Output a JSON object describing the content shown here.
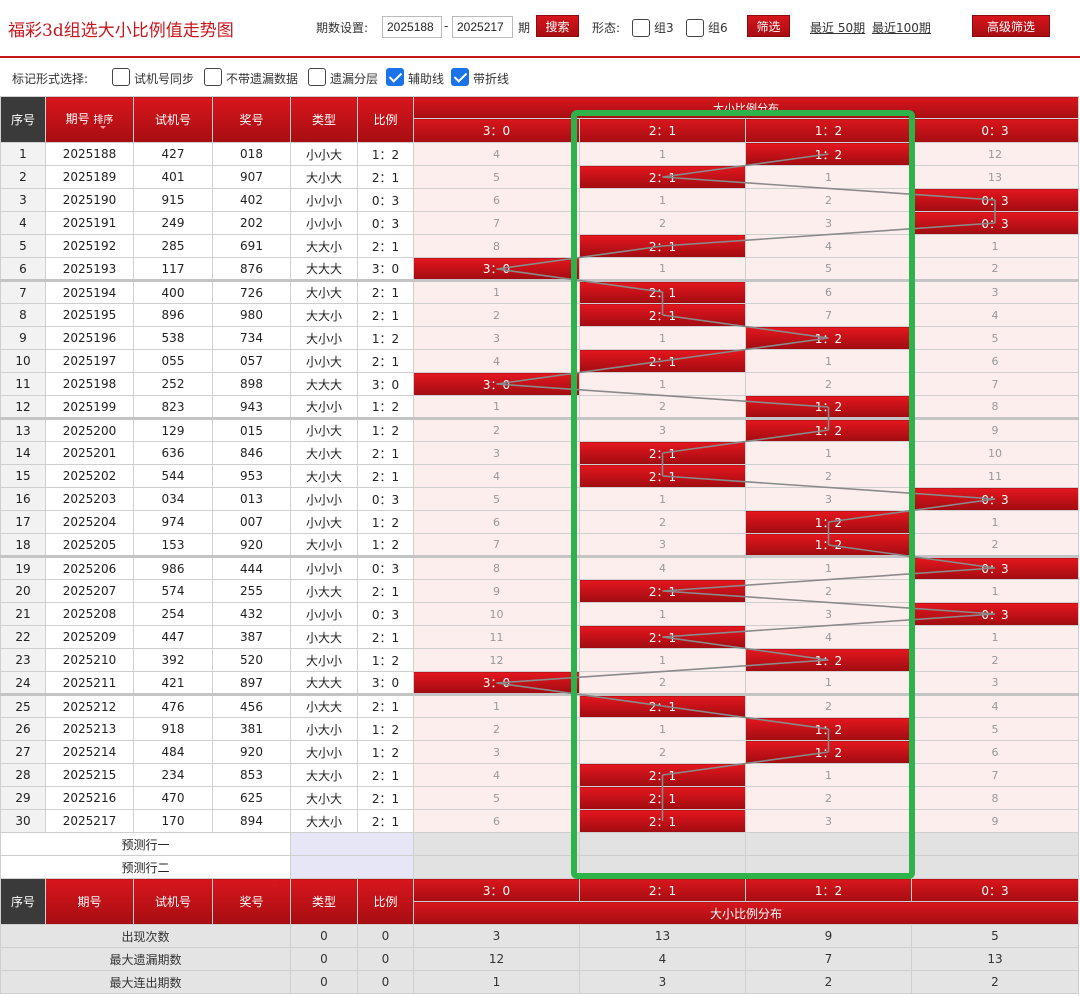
{
  "page": {
    "title": "福彩3d组选大小比例值走势图"
  },
  "toolbar": {
    "period_label": "期数设置:",
    "start_period": "2025188",
    "dash": "-",
    "end_period": "2025217",
    "period_suffix": "期",
    "search_label": "搜索",
    "shape_label": "形态:",
    "group3_label": "组3",
    "group6_label": "组6",
    "filter_label": "筛选",
    "recent50_label": "最近 50期",
    "recent100_label": "最近100期",
    "advanced_label": "高级筛选"
  },
  "markers": {
    "label": "标记形式选择:",
    "options": [
      {
        "label": "试机号同步",
        "checked": false
      },
      {
        "label": "不带遗漏数据",
        "checked": false
      },
      {
        "label": "遗漏分层",
        "checked": false
      },
      {
        "label": "辅助线",
        "checked": true
      },
      {
        "label": "带折线",
        "checked": true
      }
    ]
  },
  "table": {
    "headers": {
      "idx": "序号",
      "period": "期号",
      "sort": "排序",
      "trial": "试机号",
      "draw": "奖号",
      "type": "类型",
      "ratio": "比例",
      "dist_title": "大小比例分布",
      "dist_cols": [
        "3：0",
        "2：1",
        "1：2",
        "0：3"
      ]
    },
    "rows": [
      {
        "idx": "1",
        "period": "2025188",
        "trial": "427",
        "draw": "018",
        "type": "小小大",
        "ratio": "1：2",
        "hit": 2,
        "dist": [
          "4",
          "1",
          "1：2",
          "12"
        ]
      },
      {
        "idx": "2",
        "period": "2025189",
        "trial": "401",
        "draw": "907",
        "type": "大小大",
        "ratio": "2：1",
        "hit": 1,
        "dist": [
          "5",
          "2：1",
          "1",
          "13"
        ]
      },
      {
        "idx": "3",
        "period": "2025190",
        "trial": "915",
        "draw": "402",
        "type": "小小小",
        "ratio": "0：3",
        "hit": 3,
        "dist": [
          "6",
          "1",
          "2",
          "0：3"
        ]
      },
      {
        "idx": "4",
        "period": "2025191",
        "trial": "249",
        "draw": "202",
        "type": "小小小",
        "ratio": "0：3",
        "hit": 3,
        "dist": [
          "7",
          "2",
          "3",
          "0：3"
        ]
      },
      {
        "idx": "5",
        "period": "2025192",
        "trial": "285",
        "draw": "691",
        "type": "大大小",
        "ratio": "2：1",
        "hit": 1,
        "dist": [
          "8",
          "2：1",
          "4",
          "1"
        ]
      },
      {
        "idx": "6",
        "period": "2025193",
        "trial": "117",
        "draw": "876",
        "type": "大大大",
        "ratio": "3：0",
        "hit": 0,
        "dist": [
          "3：0",
          "1",
          "5",
          "2"
        ]
      },
      {
        "idx": "7",
        "period": "2025194",
        "trial": "400",
        "draw": "726",
        "type": "大小大",
        "ratio": "2：1",
        "hit": 1,
        "dist": [
          "1",
          "2：1",
          "6",
          "3"
        ]
      },
      {
        "idx": "8",
        "period": "2025195",
        "trial": "896",
        "draw": "980",
        "type": "大大小",
        "ratio": "2：1",
        "hit": 1,
        "dist": [
          "2",
          "2：1",
          "7",
          "4"
        ]
      },
      {
        "idx": "9",
        "period": "2025196",
        "trial": "538",
        "draw": "734",
        "type": "大小小",
        "ratio": "1：2",
        "hit": 2,
        "dist": [
          "3",
          "1",
          "1：2",
          "5"
        ]
      },
      {
        "idx": "10",
        "period": "2025197",
        "trial": "055",
        "draw": "057",
        "type": "小小大",
        "ratio": "2：1",
        "hit": 1,
        "dist": [
          "4",
          "2：1",
          "1",
          "6"
        ]
      },
      {
        "idx": "11",
        "period": "2025198",
        "trial": "252",
        "draw": "898",
        "type": "大大大",
        "ratio": "3：0",
        "hit": 0,
        "dist": [
          "3：0",
          "1",
          "2",
          "7"
        ]
      },
      {
        "idx": "12",
        "period": "2025199",
        "trial": "823",
        "draw": "943",
        "type": "大小小",
        "ratio": "1：2",
        "hit": 2,
        "dist": [
          "1",
          "2",
          "1：2",
          "8"
        ]
      },
      {
        "idx": "13",
        "period": "2025200",
        "trial": "129",
        "draw": "015",
        "type": "小小大",
        "ratio": "1：2",
        "hit": 2,
        "dist": [
          "2",
          "3",
          "1：2",
          "9"
        ]
      },
      {
        "idx": "14",
        "period": "2025201",
        "trial": "636",
        "draw": "846",
        "type": "大小大",
        "ratio": "2：1",
        "hit": 1,
        "dist": [
          "3",
          "2：1",
          "1",
          "10"
        ]
      },
      {
        "idx": "15",
        "period": "2025202",
        "trial": "544",
        "draw": "953",
        "type": "大小大",
        "ratio": "2：1",
        "hit": 1,
        "dist": [
          "4",
          "2：1",
          "2",
          "11"
        ]
      },
      {
        "idx": "16",
        "period": "2025203",
        "trial": "034",
        "draw": "013",
        "type": "小小小",
        "ratio": "0：3",
        "hit": 3,
        "dist": [
          "5",
          "1",
          "3",
          "0：3"
        ]
      },
      {
        "idx": "17",
        "period": "2025204",
        "trial": "974",
        "draw": "007",
        "type": "小小大",
        "ratio": "1：2",
        "hit": 2,
        "dist": [
          "6",
          "2",
          "1：2",
          "1"
        ]
      },
      {
        "idx": "18",
        "period": "2025205",
        "trial": "153",
        "draw": "920",
        "type": "大小小",
        "ratio": "1：2",
        "hit": 2,
        "dist": [
          "7",
          "3",
          "1：2",
          "2"
        ]
      },
      {
        "idx": "19",
        "period": "2025206",
        "trial": "986",
        "draw": "444",
        "type": "小小小",
        "ratio": "0：3",
        "hit": 3,
        "dist": [
          "8",
          "4",
          "1",
          "0：3"
        ]
      },
      {
        "idx": "20",
        "period": "2025207",
        "trial": "574",
        "draw": "255",
        "type": "小大大",
        "ratio": "2：1",
        "hit": 1,
        "dist": [
          "9",
          "2：1",
          "2",
          "1"
        ]
      },
      {
        "idx": "21",
        "period": "2025208",
        "trial": "254",
        "draw": "432",
        "type": "小小小",
        "ratio": "0：3",
        "hit": 3,
        "dist": [
          "10",
          "1",
          "3",
          "0：3"
        ]
      },
      {
        "idx": "22",
        "period": "2025209",
        "trial": "447",
        "draw": "387",
        "type": "小大大",
        "ratio": "2：1",
        "hit": 1,
        "dist": [
          "11",
          "2：1",
          "4",
          "1"
        ]
      },
      {
        "idx": "23",
        "period": "2025210",
        "trial": "392",
        "draw": "520",
        "type": "大小小",
        "ratio": "1：2",
        "hit": 2,
        "dist": [
          "12",
          "1",
          "1：2",
          "2"
        ]
      },
      {
        "idx": "24",
        "period": "2025211",
        "trial": "421",
        "draw": "897",
        "type": "大大大",
        "ratio": "3：0",
        "hit": 0,
        "dist": [
          "3：0",
          "2",
          "1",
          "3"
        ]
      },
      {
        "idx": "25",
        "period": "2025212",
        "trial": "476",
        "draw": "456",
        "type": "小大大",
        "ratio": "2：1",
        "hit": 1,
        "dist": [
          "1",
          "2：1",
          "2",
          "4"
        ]
      },
      {
        "idx": "26",
        "period": "2025213",
        "trial": "918",
        "draw": "381",
        "type": "小大小",
        "ratio": "1：2",
        "hit": 2,
        "dist": [
          "2",
          "1",
          "1：2",
          "5"
        ]
      },
      {
        "idx": "27",
        "period": "2025214",
        "trial": "484",
        "draw": "920",
        "type": "大小小",
        "ratio": "1：2",
        "hit": 2,
        "dist": [
          "3",
          "2",
          "1：2",
          "6"
        ]
      },
      {
        "idx": "28",
        "period": "2025215",
        "trial": "234",
        "draw": "853",
        "type": "大大小",
        "ratio": "2：1",
        "hit": 1,
        "dist": [
          "4",
          "2：1",
          "1",
          "7"
        ]
      },
      {
        "idx": "29",
        "period": "2025216",
        "trial": "470",
        "draw": "625",
        "type": "大小大",
        "ratio": "2：1",
        "hit": 1,
        "dist": [
          "5",
          "2：1",
          "2",
          "8"
        ]
      },
      {
        "idx": "30",
        "period": "2025217",
        "trial": "170",
        "draw": "894",
        "type": "大大小",
        "ratio": "2：1",
        "hit": 1,
        "dist": [
          "6",
          "2：1",
          "3",
          "9"
        ]
      }
    ],
    "prediction": [
      "预测行一",
      "预测行二"
    ],
    "stats": [
      {
        "label": "出现次数",
        "type": "0",
        "ratio": "0",
        "vals": [
          "3",
          "13",
          "9",
          "5"
        ]
      },
      {
        "label": "最大遗漏期数",
        "type": "0",
        "ratio": "0",
        "vals": [
          "12",
          "4",
          "7",
          "13"
        ]
      },
      {
        "label": "最大连出期数",
        "type": "0",
        "ratio": "0",
        "vals": [
          "1",
          "3",
          "2",
          "2"
        ]
      }
    ]
  },
  "colors": {
    "brand_red": "#c8161d",
    "hit_red": "#d0131a",
    "miss_bg": "#fdeeee",
    "highlight": "#2db34a",
    "trend_line": "#8a8a8a"
  }
}
